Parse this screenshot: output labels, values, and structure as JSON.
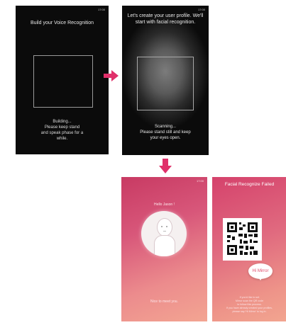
{
  "screen1": {
    "time": "17:00",
    "title": "Build your Voice Recognition",
    "caption_lines": [
      "Building...",
      "Please keep stand",
      "and speak phase for a",
      "while."
    ]
  },
  "screen2": {
    "time": "17:00",
    "title_lines": [
      "Let's create your user profile. We'll",
      "start with facial recognition."
    ],
    "caption_lines": [
      "Scanning...",
      "Please stand still and keep",
      "your eyes open."
    ]
  },
  "screen3": {
    "time": "17:00",
    "greeting": "Hello Jason !",
    "footer": "Nice to meet you."
  },
  "screen4": {
    "title": "Facial Recognize Failed",
    "bubble": "Hi Mirror",
    "small_lines": [
      "If you'd like to set",
      "Mirror scan the QR code",
      "to follow this process.",
      "If you have already created your profiles,",
      "please say 'Hi Mirror' to log in."
    ]
  },
  "colors": {
    "arrow": "#e0306a",
    "pink_start": "#c83a63",
    "pink_end": "#f3a592",
    "dark_bg": "#0b0b0b"
  },
  "icons": [
    "arrow-right-icon",
    "arrow-down-icon",
    "face-avatar-icon",
    "qr-code-icon"
  ]
}
